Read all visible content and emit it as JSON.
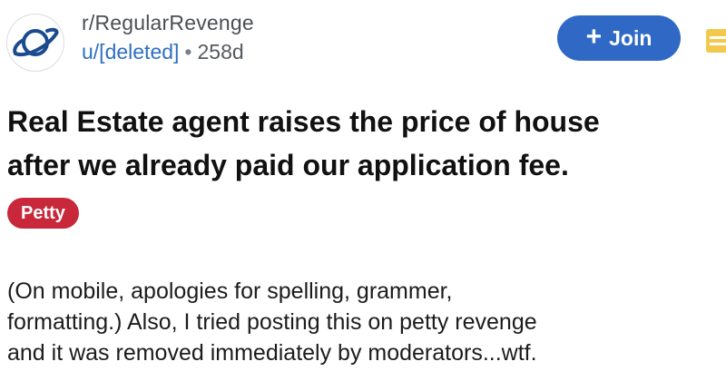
{
  "post": {
    "subreddit": "r/RegularRevenge",
    "author": "u/[deleted]",
    "separator": "•",
    "age": "258d",
    "join_label": "Join",
    "join_icon": "plus-icon",
    "title_line1": "Real Estate agent raises the price of house",
    "title_line2": "after we already paid our application fee.",
    "flair": "Petty",
    "body_line1": "(On mobile, apologies for spelling, grammer,",
    "body_line2": "formatting.) Also, I tried posting this on petty revenge",
    "body_line3": "and it was removed immediately by moderators...wtf."
  },
  "colors": {
    "join_button": "#2f69c5",
    "flair_background": "#c8283a",
    "username": "#2f6fc2",
    "subreddit_icon": "#1b4b8f"
  }
}
